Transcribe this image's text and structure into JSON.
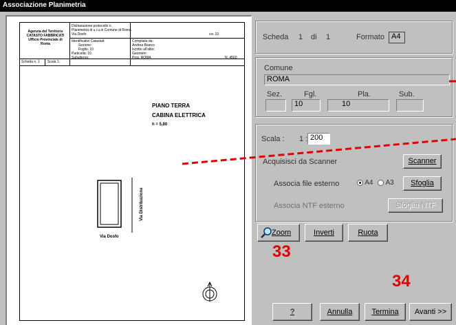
{
  "window": {
    "title": "Associazione Planimetria"
  },
  "sheet": {
    "header": {
      "agency_line1": "Agenzia del Territorio",
      "agency_line2": "CATASTO FABBRICATI",
      "agency_line3": "Ufficio Provinciale di",
      "agency_line4": "Roma",
      "dich_line1": "Dichiarazione protocollo n.",
      "dich_line2": "Planimetria di u.i.u.in Comune di Roma",
      "dich_line3": "Via Dosfo",
      "dich_civ": "civ. 10",
      "id_line1": "Identificativi Catastali:",
      "id_line2": "Sezione:",
      "id_line3": "Foglio: 10",
      "id_line4": "Particella: 10",
      "id_line5": "Subalterno:",
      "comp_line1": "Compilata da:",
      "comp_line2": "Andrea Bianco",
      "comp_line3": "Iscritto all'albo:",
      "comp_line4": "Geometri",
      "prov": "Prov. ROMA",
      "num": "N. 4560",
      "scheda": "Scheda n. 1",
      "scala": "Scala 1:"
    },
    "plan_title1": "PIANO TERRA",
    "plan_title2": "CABINA ELETTRICA",
    "plan_height": "h = 5,80",
    "street_vertical": "Via Distribuzione",
    "street_horizontal": "Via Dosfo"
  },
  "panel": {
    "scheda_label": "Scheda",
    "scheda_num": "1",
    "di_label": "di",
    "scheda_total": "1",
    "formato_label": "Formato",
    "formato_value": "A4",
    "comune_label": "Comune",
    "comune_value": "ROMA",
    "sez_label": "Sez.",
    "fgl_label": "Fgl.",
    "pla_label": "Pla.",
    "sub_label": "Sub.",
    "sez_value": "",
    "fgl_value": "10",
    "pla_value": "10",
    "sub_value": "",
    "scala_label": "Scala :",
    "scala_prefix": "1 :",
    "scala_value": "200",
    "acquisisci_label": "Acquisisci da Scanner",
    "scanner_button": "Scanner",
    "associa_file_label": "Associa file esterno",
    "radio_a4": "A4",
    "radio_a3": "A3",
    "sfoglia_button": "Sfoglia",
    "associa_ntf_label": "Associa NTF esterno",
    "sfoglia_ntf_button": "Sfoglia NTF",
    "zoom_button": "Zoom",
    "inverti_button": "Inverti",
    "ruota_button": "Ruota",
    "help_button": "?",
    "annulla_button": "Annulla",
    "termina_button": "Termina",
    "avanti_button": "Avanti >>"
  },
  "annotations": {
    "a33": "33",
    "a34": "34"
  },
  "colors": {
    "annotation": "#e00000",
    "titlebar": "#000000"
  }
}
